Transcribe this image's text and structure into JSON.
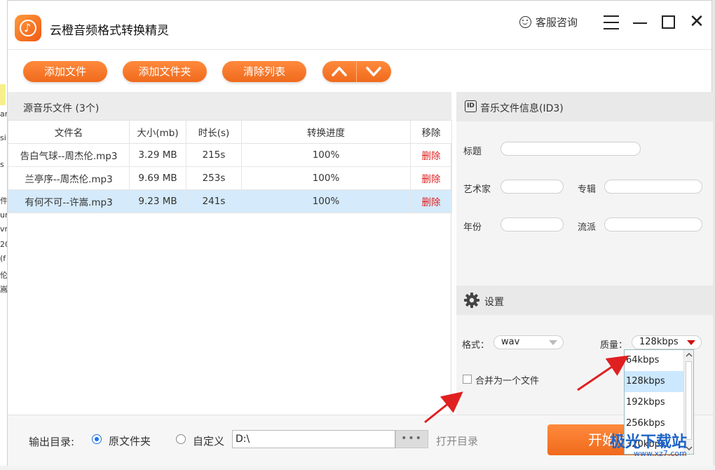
{
  "app": {
    "title": "云橙音频格式转换精灵",
    "service_label": "客服咨询"
  },
  "toolbar": {
    "add_file": "添加文件",
    "add_folder": "添加文件夹",
    "clear_list": "清除列表"
  },
  "source": {
    "title": "源音乐文件 (3个)",
    "columns": [
      "文件名",
      "大小(mb)",
      "时长(s)",
      "转换进度",
      "移除"
    ],
    "rows": [
      {
        "name": "告白气球--周杰伦.mp3",
        "size": "3.29 MB",
        "duration": "215s",
        "progress": "100%",
        "remove": "删除",
        "selected": false
      },
      {
        "name": "兰亭序--周杰伦.mp3",
        "size": "9.69 MB",
        "duration": "253s",
        "progress": "100%",
        "remove": "删除",
        "selected": false
      },
      {
        "name": "有何不可--许嵩.mp3",
        "size": "9.23 MB",
        "duration": "241s",
        "progress": "100%",
        "remove": "删除",
        "selected": true
      }
    ]
  },
  "id3": {
    "title": "音乐文件信息(ID3)",
    "badge": "ID",
    "fields": {
      "title": "标题",
      "artist": "艺术家",
      "album": "专辑",
      "year": "年份",
      "genre": "流派"
    }
  },
  "settings": {
    "title": "设置",
    "format_label": "格式：",
    "format_value": "wav",
    "quality_label": "质量：",
    "quality_value": "128kbps",
    "merge_label": "合并为一个文件",
    "quality_options": [
      "64kbps",
      "128kbps",
      "192kbps",
      "256kbps",
      "320kbps"
    ],
    "quality_highlighted": "128kbps"
  },
  "output": {
    "label": "输出目录:",
    "option_original": "原文件夹",
    "option_custom": "自定义",
    "path": "D:\\",
    "browse": "•••",
    "open_dir": "打开目录",
    "start_button": "开始转换"
  },
  "watermark": {
    "text": "极光下载站",
    "sub": "www.xz7.com"
  },
  "background_fragments": [
    "ar",
    "si",
    "s",
    "件",
    "un",
    "vr",
    "20",
    "(f",
    "伦.",
    "嵩."
  ],
  "colors": {
    "accent": "#f07020",
    "selected_row": "#d5eafa",
    "delete_red": "#e02020",
    "annotation_arrow": "#e02020"
  }
}
